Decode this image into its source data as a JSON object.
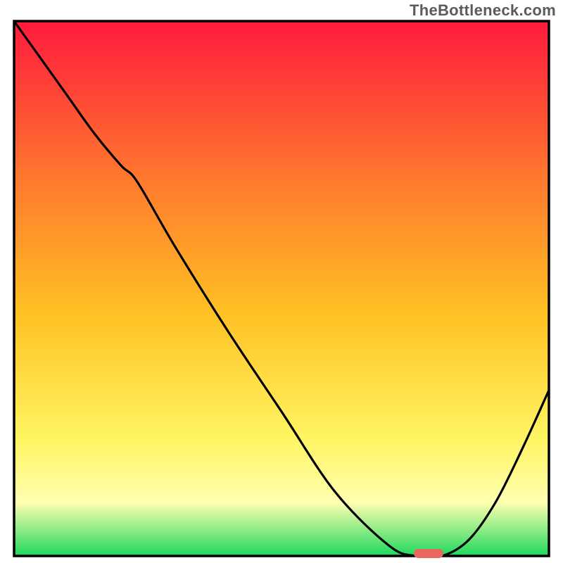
{
  "attribution": "TheBottleneck.com",
  "colors": {
    "gradient_top": "#ff1a3d",
    "gradient_upper_mid": "#ff7a2e",
    "gradient_mid": "#ffc224",
    "gradient_lower_mid": "#fff562",
    "gradient_low": "#ffffb0",
    "gradient_bottom": "#1fd85e",
    "curve": "#000000",
    "frame": "#000000",
    "marker": "#e8675e"
  },
  "chart_data": {
    "type": "line",
    "title": "",
    "xlabel": "",
    "ylabel": "",
    "x": [
      0.0,
      0.05,
      0.1,
      0.15,
      0.2,
      0.23,
      0.3,
      0.4,
      0.5,
      0.6,
      0.7,
      0.75,
      0.8,
      0.85,
      0.9,
      0.95,
      1.0
    ],
    "values": [
      1.0,
      0.93,
      0.86,
      0.79,
      0.73,
      0.7,
      0.58,
      0.42,
      0.27,
      0.12,
      0.02,
      0.0,
      0.0,
      0.03,
      0.1,
      0.2,
      0.31
    ],
    "xlim": [
      0,
      1
    ],
    "ylim": [
      0,
      1
    ],
    "marker": {
      "x": 0.775,
      "y": 0.005,
      "width_frac": 0.055,
      "height_frac": 0.017
    },
    "note": "Values are fractions of plot area; y=0 is bottom of the framed plot, y=1 is top. No axis tick labels are shown in the image."
  }
}
